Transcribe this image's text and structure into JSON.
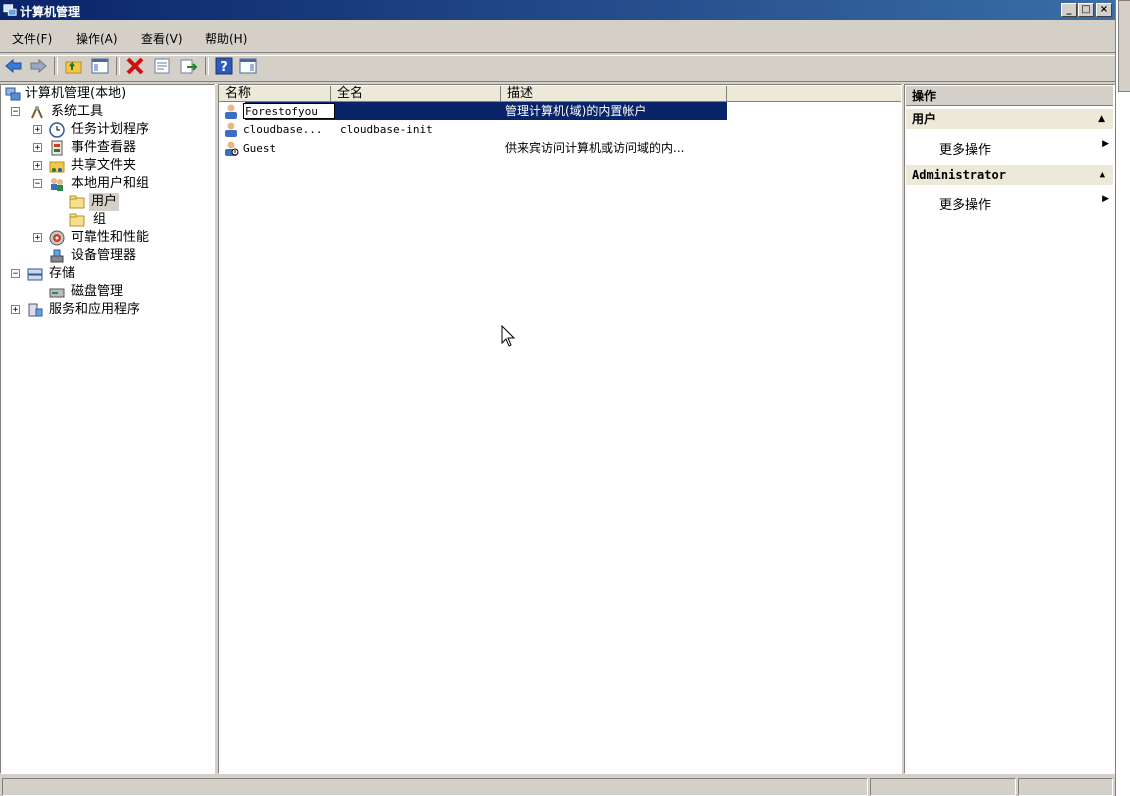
{
  "window": {
    "title": "计算机管理",
    "controls": [
      "_",
      "□",
      "×"
    ]
  },
  "menubar": {
    "items": [
      "文件(F)",
      "操作(A)",
      "查看(V)",
      "帮助(H)"
    ]
  },
  "toolbar": {
    "icons": [
      "back-icon",
      "forward-icon",
      "up-folder-icon",
      "show-hide-tree-icon",
      "delete-icon",
      "properties-icon",
      "export-icon",
      "help-icon",
      "show-hide-action-icon"
    ]
  },
  "tree": {
    "nodes": [
      {
        "label": "计算机管理(本地)",
        "expander": ""
      },
      {
        "label": "系统工具",
        "expander": "−"
      },
      {
        "label": "任务计划程序",
        "expander": "+"
      },
      {
        "label": "事件查看器",
        "expander": "+"
      },
      {
        "label": "共享文件夹",
        "expander": "+"
      },
      {
        "label": "本地用户和组",
        "expander": "−"
      },
      {
        "label": "用户",
        "expander": "",
        "selected": true
      },
      {
        "label": "组",
        "expander": ""
      },
      {
        "label": "可靠性和性能",
        "expander": "+"
      },
      {
        "label": "设备管理器",
        "expander": ""
      },
      {
        "label": "存储",
        "expander": "−"
      },
      {
        "label": "磁盘管理",
        "expander": ""
      },
      {
        "label": "服务和应用程序",
        "expander": "+"
      }
    ]
  },
  "list": {
    "columns": [
      "名称",
      "全名",
      "描述"
    ],
    "rows": [
      {
        "name": "Forestofyou",
        "fullname": "",
        "description": "管理计算机(域)的内置帐户",
        "selected": true,
        "editing": true
      },
      {
        "name": "cloudbase...",
        "fullname": "cloudbase-init",
        "description": ""
      },
      {
        "name": "Guest",
        "fullname": "",
        "description": "供来宾访问计算机或访问域的内..."
      }
    ]
  },
  "actions": {
    "title": "操作",
    "groups": [
      {
        "heading": "用户",
        "item": "更多操作"
      },
      {
        "heading": "Administrator",
        "item": "更多操作"
      }
    ]
  },
  "colors": {
    "titlebar": "#0a246a",
    "selection": "#0a246a",
    "chrome": "#d4d0c8"
  }
}
